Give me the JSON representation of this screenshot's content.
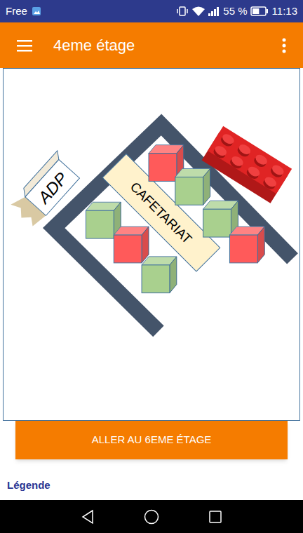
{
  "status_bar": {
    "carrier": "Free",
    "battery": "55 %",
    "battery_level": 0.55,
    "time": "11:13"
  },
  "toolbar": {
    "title": "4eme étage"
  },
  "map": {
    "labels": {
      "office": "ADP",
      "room": "CAFETARIAT"
    },
    "rooms": [
      {
        "color": "#ff5a5a"
      },
      {
        "color": "#a9d08e"
      },
      {
        "color": "#a9d08e"
      },
      {
        "color": "#ff5a5a"
      },
      {
        "color": "#a9d08e"
      },
      {
        "color": "#ff5a5a"
      },
      {
        "color": "#a9d08e"
      }
    ]
  },
  "button": {
    "label": "ALLER AU 6EME ÉTAGE"
  },
  "legend": {
    "title": "Légende"
  }
}
